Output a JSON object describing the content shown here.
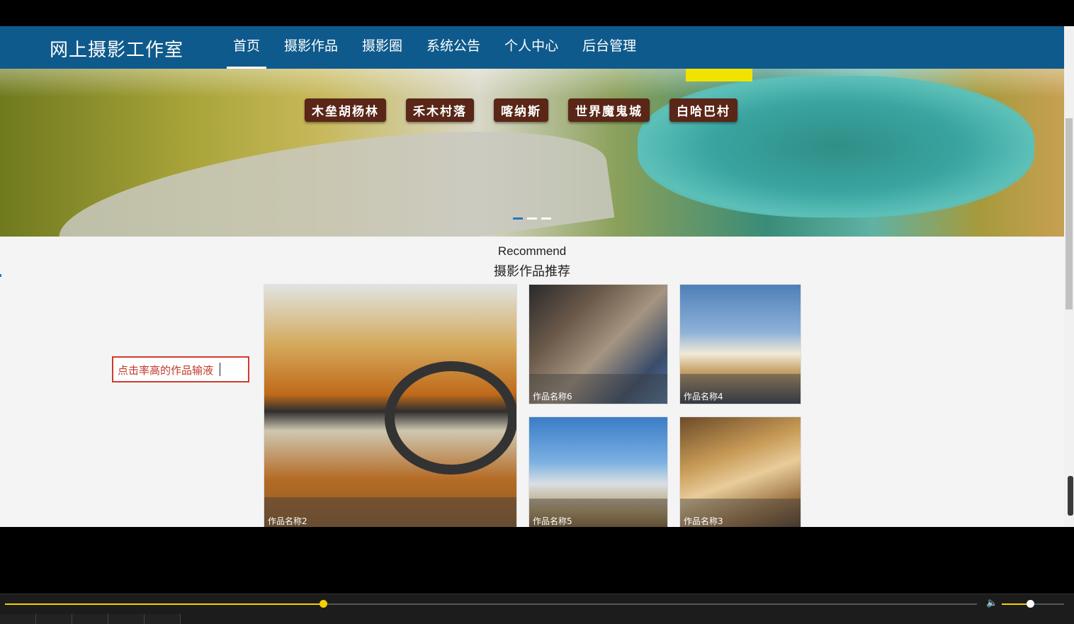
{
  "brand": "网上摄影工作室",
  "nav": [
    {
      "label": "首页",
      "active": true
    },
    {
      "label": "摄影作品",
      "active": false
    },
    {
      "label": "摄影圈",
      "active": false
    },
    {
      "label": "系统公告",
      "active": false
    },
    {
      "label": "个人中心",
      "active": false
    },
    {
      "label": "后台管理",
      "active": false
    }
  ],
  "banner": {
    "tags": [
      "木垒胡杨林",
      "禾木村落",
      "喀纳斯",
      "世界魔鬼城",
      "白哈巴村"
    ],
    "slide_count": 3,
    "active_slide": 1
  },
  "section": {
    "title_en": "Recommend",
    "title_cn": "摄影作品推荐"
  },
  "search": {
    "value": "点击率高的作品输液"
  },
  "works": [
    {
      "id": "c2",
      "caption": "作品名称2"
    },
    {
      "id": "c6",
      "caption": "作品名称6"
    },
    {
      "id": "c4",
      "caption": "作品名称4"
    },
    {
      "id": "c5",
      "caption": "作品名称5"
    },
    {
      "id": "c3",
      "caption": "作品名称3"
    }
  ],
  "player": {
    "progress": 0.327,
    "volume": 0.45,
    "accent": "#f5d000"
  },
  "colors": {
    "nav_bg": "#0f5a8c",
    "search_border": "#d23a2a"
  }
}
